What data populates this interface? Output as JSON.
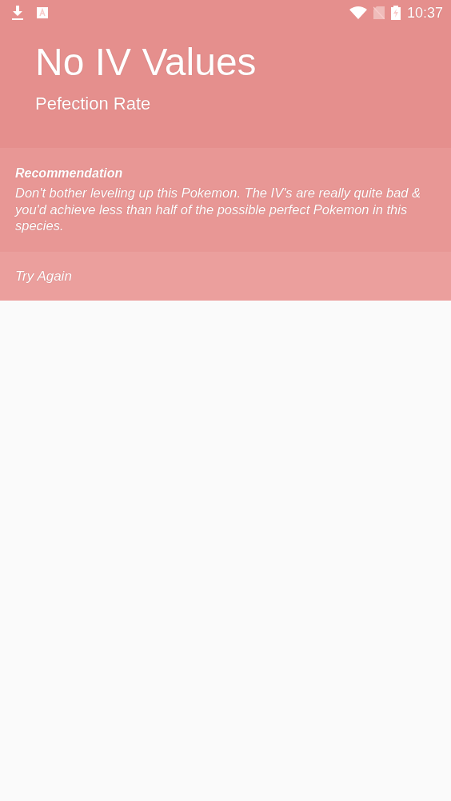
{
  "status_bar": {
    "time": "10:37"
  },
  "header": {
    "title": "No IV Values",
    "subtitle": "Pefection Rate"
  },
  "recommendation": {
    "heading": "Recommendation",
    "text": "Don't bother leveling up this Pokemon. The IV's are really quite bad & you'd achieve less than half of the possible perfect Pokemon in this species."
  },
  "action": {
    "label": "Try Again"
  }
}
